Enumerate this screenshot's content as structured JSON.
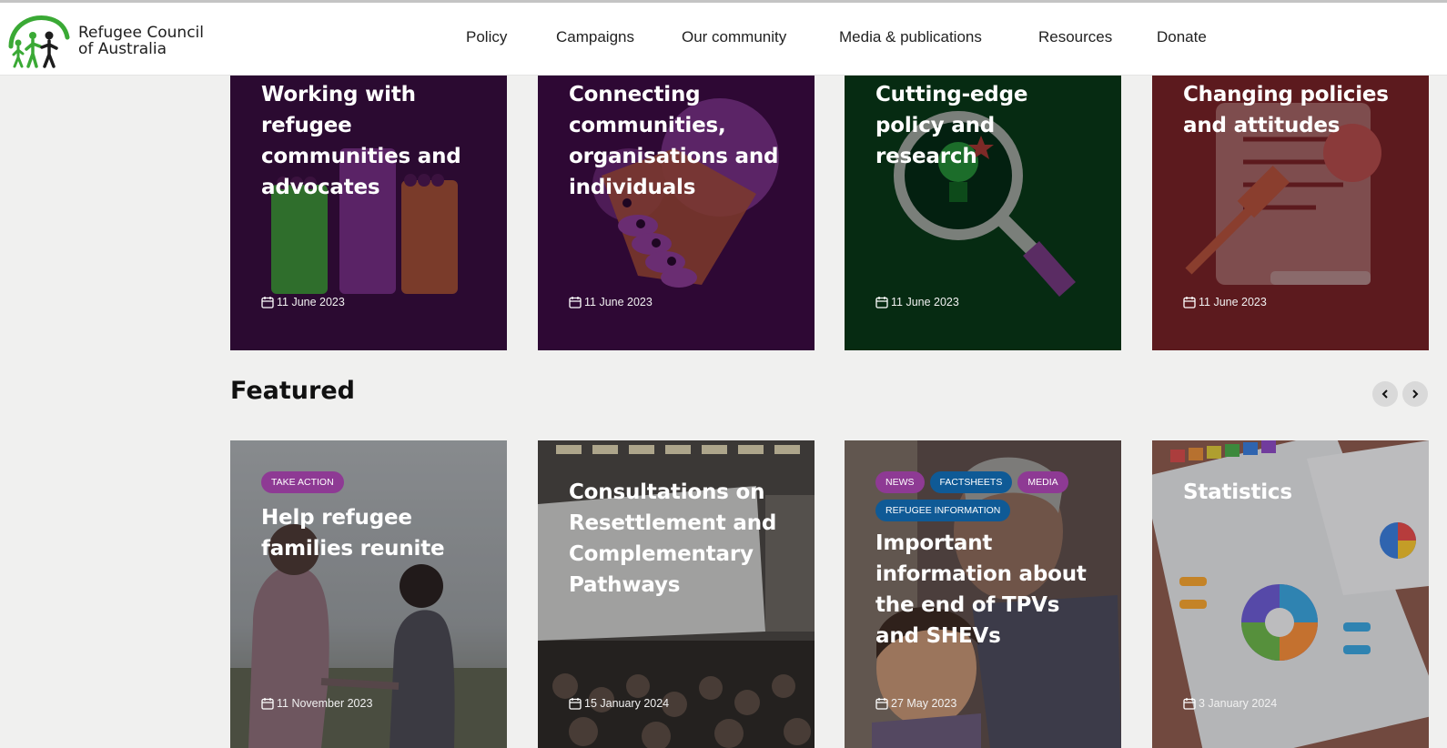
{
  "header": {
    "logo_line1": "Refugee Council",
    "logo_line2": "of Australia",
    "nav": [
      "Policy",
      "Campaigns",
      "Our community",
      "Media & publications",
      "Resources",
      "Donate"
    ]
  },
  "top_cards": [
    {
      "title": "Working with refugee communities and advocates",
      "date": "11 June 2023",
      "bg": "#2b0a31",
      "illustration": "raised-fists"
    },
    {
      "title": "Connecting communities, organisations and individuals",
      "date": "11 June 2023",
      "bg": "#2e0834",
      "illustration": "handshake-heart"
    },
    {
      "title": "Cutting-edge policy and research",
      "date": "11 June 2023",
      "bg": "#062b12",
      "illustration": "magnifier-lightbulb"
    },
    {
      "title": "Changing policies and attitudes",
      "date": "11 June 2023",
      "bg": "#5c1a1e",
      "illustration": "document-gavel"
    }
  ],
  "featured": {
    "heading": "Featured",
    "prev_icon": "chevron-left-icon",
    "next_icon": "chevron-right-icon",
    "cards": [
      {
        "title": "Help refugee families reunite",
        "date": "11 November 2023",
        "tags": [
          "TAKE ACTION"
        ],
        "image": "family-holding-hands-photo"
      },
      {
        "title": "Consultations on Resettlement and Complementary Pathways",
        "date": "15 January 2024",
        "tags": [],
        "image": "conference-hall-photo"
      },
      {
        "title": "Important information about the end of TPVs and SHEVs",
        "date": "27 May 2023",
        "tags": [
          "NEWS",
          "FACTSHEETS",
          "MEDIA",
          "REFUGEE INFORMATION"
        ],
        "image": "father-and-child-photo"
      },
      {
        "title": "Statistics",
        "date": "3 January 2024",
        "tags": [],
        "image": "charts-on-desk-photo"
      }
    ]
  },
  "colors": {
    "purple_tag": "#8e3a94",
    "blue_tag": "#0f5a96",
    "logo_green": "#3aa935"
  }
}
